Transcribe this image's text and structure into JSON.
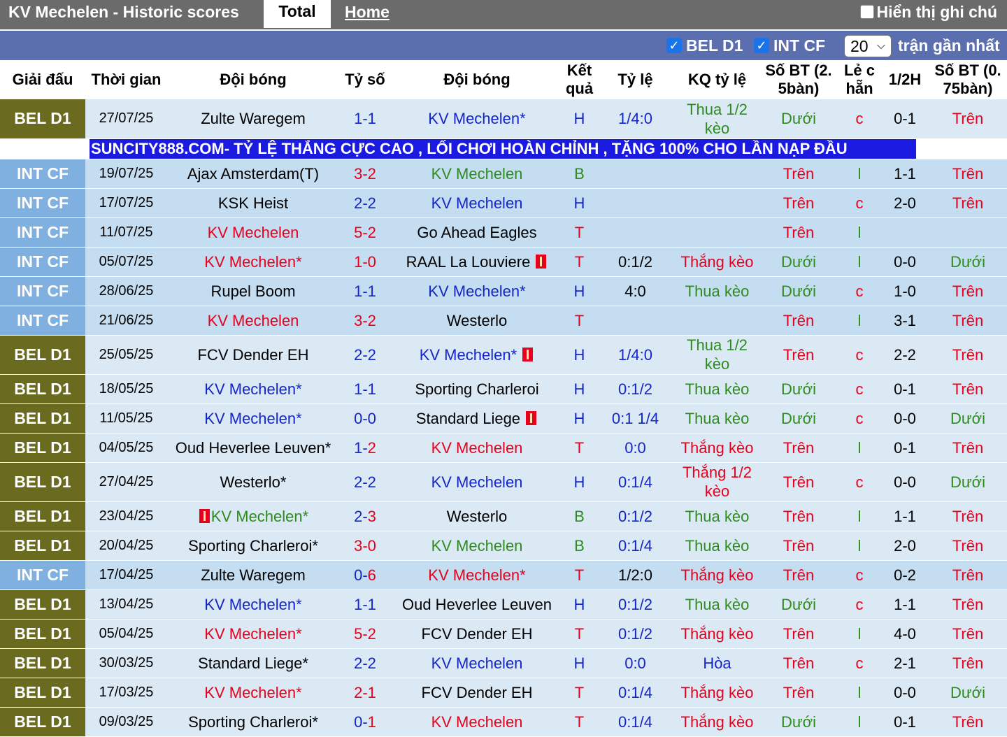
{
  "header": {
    "title": "KV Mechelen - Historic scores",
    "tab_total": "Total",
    "tab_home": "Home",
    "hide_notes": "Hiển thị ghi chú"
  },
  "filters": {
    "bel": "BEL D1",
    "int": "INT CF",
    "count": "20",
    "recent": "trận gần nhất"
  },
  "columns": [
    "Giải đấu",
    "Thời gian",
    "Đội bóng",
    "Tỷ số",
    "Đội bóng",
    "Kết quả",
    "Tỷ lệ",
    "KQ tỷ lệ",
    "Số BT (2. 5bàn)",
    "Lẻ c hẵn",
    "1/2H",
    "Số BT (0. 75bàn)"
  ],
  "ad": "SUNCITY888.COM- TỶ LỆ THẮNG CỰC CAO , LỐI CHƠI HOÀN CHỈNH , TẶNG 100% CHO LẦN NẠP ĐẦU",
  "colors": {
    "red": "#e8001c",
    "blue": "#1426c8",
    "green": "#2e8b1e"
  },
  "rows": [
    {
      "league": "BEL D1",
      "date": "27/07/25",
      "home": "Zulte Waregem",
      "hc": "black",
      "hf": "",
      "sh": "1",
      "sa": "1",
      "shc": "blue",
      "sac": "blue",
      "away": "KV Mechelen*",
      "ac": "blue",
      "af": "",
      "res": "H",
      "rc": "blue",
      "odds": "1/4:0",
      "oc": "blue",
      "kq": "Thua 1/2 kèo",
      "kqc": "green",
      "bt": "Dưới",
      "btc": "green",
      "lc": "c",
      "lcc": "red",
      "half": "0-1",
      "bt2": "Trên",
      "bt2c": "red",
      "tall": true
    },
    {
      "league": "INT CF",
      "date": "19/07/25",
      "home": "Ajax Amsterdam(T)",
      "hc": "black",
      "hf": "",
      "sh": "3",
      "sa": "2",
      "shc": "red",
      "sac": "red",
      "away": "KV Mechelen",
      "ac": "green",
      "af": "",
      "res": "B",
      "rc": "green",
      "odds": "",
      "oc": "black",
      "kq": "",
      "kqc": "black",
      "bt": "Trên",
      "btc": "red",
      "lc": "l",
      "lcc": "green",
      "half": "1-1",
      "bt2": "Trên",
      "bt2c": "red",
      "tall": false
    },
    {
      "league": "INT CF",
      "date": "17/07/25",
      "home": "KSK Heist",
      "hc": "black",
      "hf": "",
      "sh": "2",
      "sa": "2",
      "shc": "blue",
      "sac": "blue",
      "away": "KV Mechelen",
      "ac": "blue",
      "af": "",
      "res": "H",
      "rc": "blue",
      "odds": "",
      "oc": "black",
      "kq": "",
      "kqc": "black",
      "bt": "Trên",
      "btc": "red",
      "lc": "c",
      "lcc": "red",
      "half": "2-0",
      "bt2": "Trên",
      "bt2c": "red",
      "tall": false
    },
    {
      "league": "INT CF",
      "date": "11/07/25",
      "home": "KV Mechelen",
      "hc": "red",
      "hf": "",
      "sh": "5",
      "sa": "2",
      "shc": "red",
      "sac": "red",
      "away": "Go Ahead Eagles",
      "ac": "black",
      "af": "",
      "res": "T",
      "rc": "red",
      "odds": "",
      "oc": "black",
      "kq": "",
      "kqc": "black",
      "bt": "Trên",
      "btc": "red",
      "lc": "l",
      "lcc": "green",
      "half": "",
      "bt2": "",
      "bt2c": "red",
      "tall": false
    },
    {
      "league": "INT CF",
      "date": "05/07/25",
      "home": "KV Mechelen*",
      "hc": "red",
      "hf": "",
      "sh": "1",
      "sa": "0",
      "shc": "red",
      "sac": "red",
      "away": "RAAL La Louviere",
      "ac": "black",
      "af": "after",
      "res": "T",
      "rc": "red",
      "odds": "0:1/2",
      "oc": "black",
      "kq": "Thắng kèo",
      "kqc": "red",
      "bt": "Dưới",
      "btc": "green",
      "lc": "l",
      "lcc": "green",
      "half": "0-0",
      "bt2": "Dưới",
      "bt2c": "green",
      "tall": false
    },
    {
      "league": "INT CF",
      "date": "28/06/25",
      "home": "Rupel Boom",
      "hc": "black",
      "hf": "",
      "sh": "1",
      "sa": "1",
      "shc": "blue",
      "sac": "blue",
      "away": "KV Mechelen*",
      "ac": "blue",
      "af": "",
      "res": "H",
      "rc": "blue",
      "odds": "4:0",
      "oc": "black",
      "kq": "Thua kèo",
      "kqc": "green",
      "bt": "Dưới",
      "btc": "green",
      "lc": "c",
      "lcc": "red",
      "half": "1-0",
      "bt2": "Trên",
      "bt2c": "red",
      "tall": false
    },
    {
      "league": "INT CF",
      "date": "21/06/25",
      "home": "KV Mechelen",
      "hc": "red",
      "hf": "",
      "sh": "3",
      "sa": "2",
      "shc": "red",
      "sac": "red",
      "away": "Westerlo",
      "ac": "black",
      "af": "",
      "res": "T",
      "rc": "red",
      "odds": "",
      "oc": "black",
      "kq": "",
      "kqc": "black",
      "bt": "Trên",
      "btc": "red",
      "lc": "l",
      "lcc": "green",
      "half": "3-1",
      "bt2": "Trên",
      "bt2c": "red",
      "tall": false
    },
    {
      "league": "BEL D1",
      "date": "25/05/25",
      "home": "FCV Dender EH",
      "hc": "black",
      "hf": "",
      "sh": "2",
      "sa": "2",
      "shc": "blue",
      "sac": "blue",
      "away": "KV Mechelen*",
      "ac": "blue",
      "af": "after",
      "res": "H",
      "rc": "blue",
      "odds": "1/4:0",
      "oc": "blue",
      "kq": "Thua 1/2 kèo",
      "kqc": "green",
      "bt": "Trên",
      "btc": "red",
      "lc": "c",
      "lcc": "red",
      "half": "2-2",
      "bt2": "Trên",
      "bt2c": "red",
      "tall": true
    },
    {
      "league": "BEL D1",
      "date": "18/05/25",
      "home": "KV Mechelen*",
      "hc": "blue",
      "hf": "",
      "sh": "1",
      "sa": "1",
      "shc": "blue",
      "sac": "blue",
      "away": "Sporting Charleroi",
      "ac": "black",
      "af": "",
      "res": "H",
      "rc": "blue",
      "odds": "0:1/2",
      "oc": "blue",
      "kq": "Thua kèo",
      "kqc": "green",
      "bt": "Dưới",
      "btc": "green",
      "lc": "c",
      "lcc": "red",
      "half": "0-1",
      "bt2": "Trên",
      "bt2c": "red",
      "tall": false
    },
    {
      "league": "BEL D1",
      "date": "11/05/25",
      "home": "KV Mechelen*",
      "hc": "blue",
      "hf": "",
      "sh": "0",
      "sa": "0",
      "shc": "blue",
      "sac": "blue",
      "away": "Standard Liege",
      "ac": "black",
      "af": "after",
      "res": "H",
      "rc": "blue",
      "odds": "0:1 1/4",
      "oc": "blue",
      "kq": "Thua kèo",
      "kqc": "green",
      "bt": "Dưới",
      "btc": "green",
      "lc": "c",
      "lcc": "red",
      "half": "0-0",
      "bt2": "Dưới",
      "bt2c": "green",
      "tall": false
    },
    {
      "league": "BEL D1",
      "date": "04/05/25",
      "home": "Oud Heverlee Leuven*",
      "hc": "black",
      "hf": "",
      "sh": "1",
      "sa": "2",
      "shc": "blue",
      "sac": "red",
      "away": "KV Mechelen",
      "ac": "red",
      "af": "",
      "res": "T",
      "rc": "red",
      "odds": "0:0",
      "oc": "blue",
      "kq": "Thắng kèo",
      "kqc": "red",
      "bt": "Trên",
      "btc": "red",
      "lc": "l",
      "lcc": "green",
      "half": "0-1",
      "bt2": "Trên",
      "bt2c": "red",
      "tall": false
    },
    {
      "league": "BEL D1",
      "date": "27/04/25",
      "home": "Westerlo*",
      "hc": "black",
      "hf": "",
      "sh": "2",
      "sa": "2",
      "shc": "blue",
      "sac": "blue",
      "away": "KV Mechelen",
      "ac": "blue",
      "af": "",
      "res": "H",
      "rc": "blue",
      "odds": "0:1/4",
      "oc": "blue",
      "kq": "Thắng 1/2 kèo",
      "kqc": "red",
      "bt": "Trên",
      "btc": "red",
      "lc": "c",
      "lcc": "red",
      "half": "0-0",
      "bt2": "Dưới",
      "bt2c": "green",
      "tall": true
    },
    {
      "league": "BEL D1",
      "date": "23/04/25",
      "home": "KV Mechelen*",
      "hc": "green",
      "hf": "before",
      "sh": "2",
      "sa": "3",
      "shc": "blue",
      "sac": "red",
      "away": "Westerlo",
      "ac": "black",
      "af": "",
      "res": "B",
      "rc": "green",
      "odds": "0:1/2",
      "oc": "blue",
      "kq": "Thua kèo",
      "kqc": "green",
      "bt": "Trên",
      "btc": "red",
      "lc": "l",
      "lcc": "green",
      "half": "1-1",
      "bt2": "Trên",
      "bt2c": "red",
      "tall": false
    },
    {
      "league": "BEL D1",
      "date": "20/04/25",
      "home": "Sporting Charleroi*",
      "hc": "black",
      "hf": "",
      "sh": "3",
      "sa": "0",
      "shc": "red",
      "sac": "red",
      "away": "KV Mechelen",
      "ac": "green",
      "af": "",
      "res": "B",
      "rc": "green",
      "odds": "0:1/4",
      "oc": "blue",
      "kq": "Thua kèo",
      "kqc": "green",
      "bt": "Trên",
      "btc": "red",
      "lc": "l",
      "lcc": "green",
      "half": "2-0",
      "bt2": "Trên",
      "bt2c": "red",
      "tall": false
    },
    {
      "league": "INT CF",
      "date": "17/04/25",
      "home": "Zulte Waregem",
      "hc": "black",
      "hf": "",
      "sh": "0",
      "sa": "6",
      "shc": "blue",
      "sac": "red",
      "away": "KV Mechelen*",
      "ac": "red",
      "af": "",
      "res": "T",
      "rc": "red",
      "odds": "1/2:0",
      "oc": "black",
      "kq": "Thắng kèo",
      "kqc": "red",
      "bt": "Trên",
      "btc": "red",
      "lc": "c",
      "lcc": "red",
      "half": "0-2",
      "bt2": "Trên",
      "bt2c": "red",
      "tall": false
    },
    {
      "league": "BEL D1",
      "date": "13/04/25",
      "home": "KV Mechelen*",
      "hc": "blue",
      "hf": "",
      "sh": "1",
      "sa": "1",
      "shc": "blue",
      "sac": "blue",
      "away": "Oud Heverlee Leuven",
      "ac": "black",
      "af": "",
      "res": "H",
      "rc": "blue",
      "odds": "0:1/2",
      "oc": "blue",
      "kq": "Thua kèo",
      "kqc": "green",
      "bt": "Dưới",
      "btc": "green",
      "lc": "c",
      "lcc": "red",
      "half": "1-1",
      "bt2": "Trên",
      "bt2c": "red",
      "tall": false
    },
    {
      "league": "BEL D1",
      "date": "05/04/25",
      "home": "KV Mechelen*",
      "hc": "red",
      "hf": "",
      "sh": "5",
      "sa": "2",
      "shc": "red",
      "sac": "red",
      "away": "FCV Dender EH",
      "ac": "black",
      "af": "",
      "res": "T",
      "rc": "red",
      "odds": "0:1/2",
      "oc": "blue",
      "kq": "Thắng kèo",
      "kqc": "red",
      "bt": "Trên",
      "btc": "red",
      "lc": "l",
      "lcc": "green",
      "half": "4-0",
      "bt2": "Trên",
      "bt2c": "red",
      "tall": false
    },
    {
      "league": "BEL D1",
      "date": "30/03/25",
      "home": "Standard Liege*",
      "hc": "black",
      "hf": "",
      "sh": "2",
      "sa": "2",
      "shc": "blue",
      "sac": "blue",
      "away": "KV Mechelen",
      "ac": "blue",
      "af": "",
      "res": "H",
      "rc": "blue",
      "odds": "0:0",
      "oc": "blue",
      "kq": "Hòa",
      "kqc": "blue",
      "bt": "Trên",
      "btc": "red",
      "lc": "c",
      "lcc": "red",
      "half": "2-1",
      "bt2": "Trên",
      "bt2c": "red",
      "tall": false
    },
    {
      "league": "BEL D1",
      "date": "17/03/25",
      "home": "KV Mechelen*",
      "hc": "red",
      "hf": "",
      "sh": "2",
      "sa": "1",
      "shc": "red",
      "sac": "red",
      "away": "FCV Dender EH",
      "ac": "black",
      "af": "",
      "res": "T",
      "rc": "red",
      "odds": "0:1/4",
      "oc": "blue",
      "kq": "Thắng kèo",
      "kqc": "red",
      "bt": "Trên",
      "btc": "red",
      "lc": "l",
      "lcc": "green",
      "half": "0-0",
      "bt2": "Dưới",
      "bt2c": "green",
      "tall": false
    },
    {
      "league": "BEL D1",
      "date": "09/03/25",
      "home": "Sporting Charleroi*",
      "hc": "black",
      "hf": "",
      "sh": "0",
      "sa": "1",
      "shc": "blue",
      "sac": "red",
      "away": "KV Mechelen",
      "ac": "red",
      "af": "",
      "res": "T",
      "rc": "red",
      "odds": "0:1/4",
      "oc": "blue",
      "kq": "Thắng kèo",
      "kqc": "red",
      "bt": "Dưới",
      "btc": "green",
      "lc": "l",
      "lcc": "green",
      "half": "0-1",
      "bt2": "Trên",
      "bt2c": "red",
      "tall": false
    }
  ]
}
